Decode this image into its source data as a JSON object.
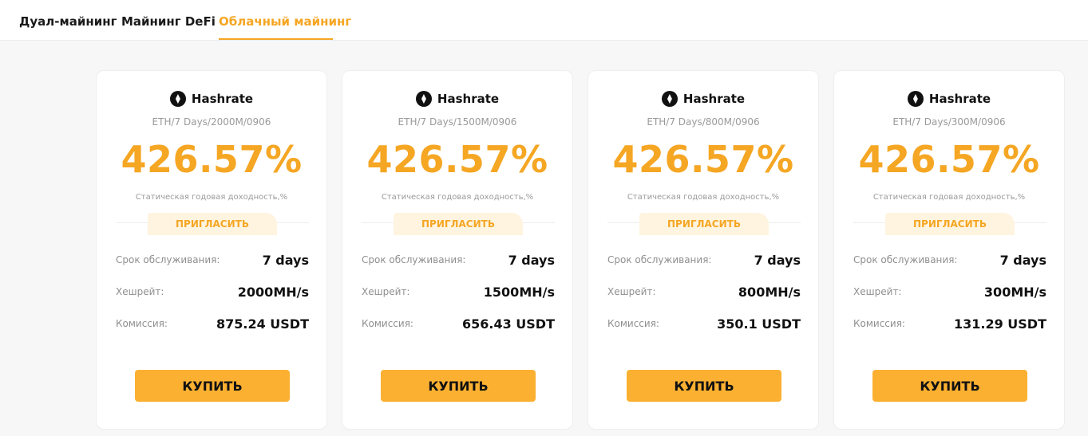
{
  "tabs": [
    {
      "label": "Дуал-майнинг",
      "active": false
    },
    {
      "label": "Майнинг DeFi",
      "active": false
    },
    {
      "label": "Облачный майнинг",
      "active": true
    }
  ],
  "colors": {
    "accent": "#f5a623",
    "button": "#fbb031",
    "invite_bg": "#fff4e0"
  },
  "cards": [
    {
      "icon": "ethereum-icon",
      "title": "Hashrate",
      "subtitle": "ETH/7 Days/2000M/0906",
      "rate": "426.57%",
      "rate_label": "Статическая годовая доходность,%",
      "invite": "ПРИГЛАСИТЬ",
      "rows": [
        {
          "label": "Срок обслуживания:",
          "value": "7 days"
        },
        {
          "label": "Хешрейт:",
          "value": "2000MH/s"
        },
        {
          "label": "Комиссия:",
          "value": "875.24 USDT"
        }
      ],
      "buy": "КУПИТЬ"
    },
    {
      "icon": "ethereum-icon",
      "title": "Hashrate",
      "subtitle": "ETH/7 Days/1500M/0906",
      "rate": "426.57%",
      "rate_label": "Статическая годовая доходность,%",
      "invite": "ПРИГЛАСИТЬ",
      "rows": [
        {
          "label": "Срок обслуживания:",
          "value": "7 days"
        },
        {
          "label": "Хешрейт:",
          "value": "1500MH/s"
        },
        {
          "label": "Комиссия:",
          "value": "656.43 USDT"
        }
      ],
      "buy": "КУПИТЬ"
    },
    {
      "icon": "ethereum-icon",
      "title": "Hashrate",
      "subtitle": "ETH/7 Days/800M/0906",
      "rate": "426.57%",
      "rate_label": "Статическая годовая доходность,%",
      "invite": "ПРИГЛАСИТЬ",
      "rows": [
        {
          "label": "Срок обслуживания:",
          "value": "7 days"
        },
        {
          "label": "Хешрейт:",
          "value": "800MH/s"
        },
        {
          "label": "Комиссия:",
          "value": "350.1 USDT"
        }
      ],
      "buy": "КУПИТЬ"
    },
    {
      "icon": "ethereum-icon",
      "title": "Hashrate",
      "subtitle": "ETH/7 Days/300M/0906",
      "rate": "426.57%",
      "rate_label": "Статическая годовая доходность,%",
      "invite": "ПРИГЛАСИТЬ",
      "rows": [
        {
          "label": "Срок обслуживания:",
          "value": "7 days"
        },
        {
          "label": "Хешрейт:",
          "value": "300MH/s"
        },
        {
          "label": "Комиссия:",
          "value": "131.29 USDT"
        }
      ],
      "buy": "КУПИТЬ"
    }
  ]
}
